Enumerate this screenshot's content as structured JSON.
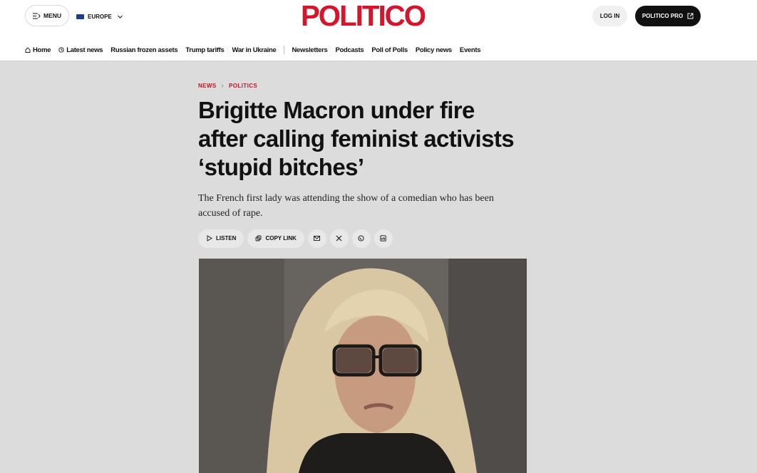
{
  "header": {
    "menu_label": "MENU",
    "edition_label": "EUROPE",
    "logo_text": "POLITICO",
    "login_label": "LOG IN",
    "pro_label": "POLITICO PRO"
  },
  "nav": {
    "items": [
      {
        "label": "Home",
        "icon": "home-icon"
      },
      {
        "label": "Latest news",
        "icon": "clock-icon"
      },
      {
        "label": "Russian frozen assets"
      },
      {
        "label": "Trump tariffs"
      },
      {
        "label": "War in Ukraine"
      }
    ],
    "secondary": [
      {
        "label": "Newsletters"
      },
      {
        "label": "Podcasts"
      },
      {
        "label": "Poll of Polls"
      },
      {
        "label": "Policy news"
      },
      {
        "label": "Events"
      }
    ]
  },
  "article": {
    "breadcrumb": [
      "NEWS",
      "POLITICS"
    ],
    "headline": "Brigitte Macron under fire after calling feminist activists ‘stupid bitches’",
    "dek": "The French first lady was attending the show of a comedian who has been accused of rape.",
    "listen_label": "LISTEN",
    "copy_link_label": "COPY LINK",
    "share_icons": [
      "email-icon",
      "x-icon",
      "whatsapp-icon",
      "linkedin-icon"
    ]
  },
  "colors": {
    "brand_red": "#d4152b",
    "page_bg": "#dcdcdc"
  }
}
